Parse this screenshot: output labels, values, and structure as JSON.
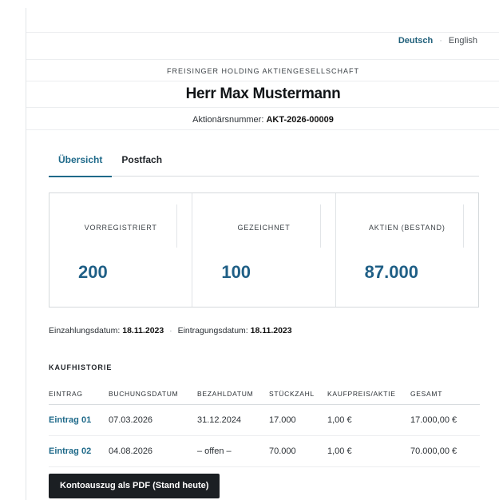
{
  "language": {
    "active": "Deutsch",
    "separator": "·",
    "other": "English"
  },
  "header": {
    "company": "FREISINGER HOLDING AKTIENGESELLSCHAFT",
    "name": "Herr Max Mustermann",
    "shareholder_label": "Aktionärsnummer:",
    "shareholder_number": "AKT-2026-00009"
  },
  "tabs": [
    {
      "label": "Übersicht",
      "active": true
    },
    {
      "label": "Postfach",
      "active": false
    }
  ],
  "stats": [
    {
      "label": "VORREGISTRIERT",
      "value": "200"
    },
    {
      "label": "GEZEICHNET",
      "value": "100"
    },
    {
      "label": "AKTIEN (BESTAND)",
      "value": "87.000"
    }
  ],
  "dates": {
    "payment_label": "Einzahlungsdatum:",
    "payment_value": "18.11.2023",
    "separator": "·",
    "registration_label": "Eintragungsdatum:",
    "registration_value": "18.11.2023"
  },
  "history": {
    "title": "KAUFHISTORIE",
    "columns": [
      "EINTRAG",
      "BUCHUNGSDATUM",
      "BEZAHLDATUM",
      "STÜCKZAHL",
      "KAUFPREIS/AKTIE",
      "GESAMT"
    ],
    "rows": [
      [
        "Eintrag 01",
        "07.03.2026",
        "31.12.2024",
        "17.000",
        "1,00 €",
        "17.000,00 €"
      ],
      [
        "Eintrag 02",
        "04.08.2026",
        "– offen –",
        "70.000",
        "1,00 €",
        "70.000,00 €"
      ]
    ]
  },
  "actions": {
    "pdf_button": "Kontoauszug als PDF (Stand heute)"
  },
  "colors": {
    "accent": "#1f6a8a",
    "stat_value": "#1f5f86",
    "button_bg": "#1b1f23"
  }
}
